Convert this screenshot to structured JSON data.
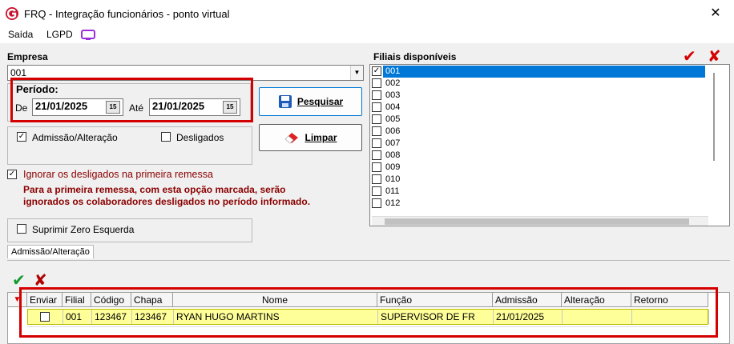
{
  "window": {
    "title": "FRQ - Integração funcionários - ponto virtual",
    "close_glyph": "✕"
  },
  "menu": {
    "items": [
      "Saída",
      "LGPD"
    ]
  },
  "empresa": {
    "label": "Empresa",
    "value": "001"
  },
  "periodo": {
    "label": "Período:",
    "de_label": "De",
    "de_value": "21/01/2025",
    "ate_label": "Até",
    "ate_value": "21/01/2025"
  },
  "buttons": {
    "pesquisar": "Pesquisar",
    "limpar": "Limpar"
  },
  "filters": {
    "admissao_label": "Admissão/Alteração",
    "admissao_checked": true,
    "desligados_label": "Desligados",
    "desligados_checked": false
  },
  "ignorar": {
    "label": "Ignorar os desligados na primeira remessa",
    "checked": true,
    "note_line1": "Para a primeira remessa, com esta opção marcada, serão",
    "note_line2": "ignorados os colaboradores desligados no período informado."
  },
  "suprimir": {
    "label": "Suprimir Zero Esquerda",
    "checked": false
  },
  "filiais": {
    "label": "Filiais disponíveis",
    "items": [
      {
        "code": "001",
        "checked": true,
        "selected": true
      },
      {
        "code": "002",
        "checked": false
      },
      {
        "code": "003",
        "checked": false
      },
      {
        "code": "004",
        "checked": false
      },
      {
        "code": "005",
        "checked": false
      },
      {
        "code": "006",
        "checked": false
      },
      {
        "code": "007",
        "checked": false
      },
      {
        "code": "008",
        "checked": false
      },
      {
        "code": "009",
        "checked": false
      },
      {
        "code": "010",
        "checked": false
      },
      {
        "code": "011",
        "checked": false
      },
      {
        "code": "012",
        "checked": false
      }
    ]
  },
  "tab": {
    "label": "Admissão/Alteração"
  },
  "grid": {
    "columns": [
      "Enviar",
      "Filial",
      "Código",
      "Chapa",
      "Nome",
      "Função",
      "Admissão",
      "Alteração",
      "Retorno"
    ],
    "rows": [
      {
        "enviar": false,
        "filial": "001",
        "codigo": "123467",
        "chapa": "123467",
        "nome": "RYAN HUGO MARTINS",
        "funcao": "SUPERVISOR DE FR",
        "admissao": "21/01/2025",
        "alteracao": "",
        "retorno": ""
      }
    ]
  },
  "colors": {
    "accent_red": "#d40000",
    "selection_blue": "#0078d7",
    "row_highlight": "#ffff99",
    "note_red": "#8b0000"
  }
}
